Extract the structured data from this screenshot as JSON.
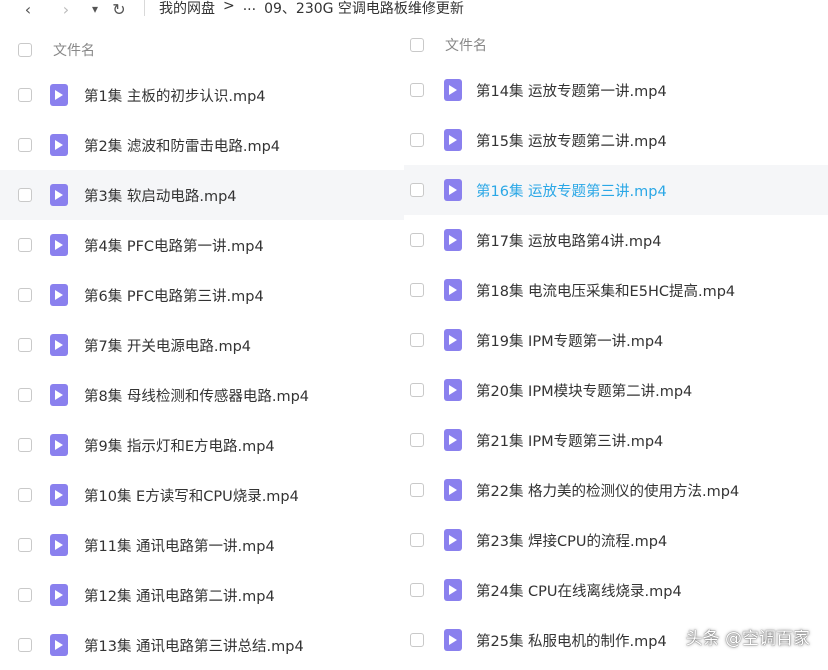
{
  "nav": {
    "back_icon": "‹",
    "forward_icon": "›",
    "dropdown_icon": "▾",
    "refresh_icon": "↻"
  },
  "breadcrumb": {
    "root": "我的网盘",
    "sep": ">",
    "ellipsis": "...",
    "current": "09、230G 空调电路板维修更新"
  },
  "left": {
    "header": "文件名",
    "files": [
      "第1集  主板的初步认识.mp4",
      "第2集 滤波和防雷击电路.mp4",
      "第3集  软启动电路.mp4",
      "第4集  PFC电路第一讲.mp4",
      "第6集 PFC电路第三讲.mp4",
      "第7集  开关电源电路.mp4",
      "第8集 母线检测和传感器电路.mp4",
      "第9集 指示灯和E方电路.mp4",
      "第10集 E方读写和CPU烧录.mp4",
      "第11集  通讯电路第一讲.mp4",
      "第12集 通讯电路第二讲.mp4",
      "第13集 通讯电路第三讲总结.mp4"
    ]
  },
  "right": {
    "header": "文件名",
    "files": [
      "第14集 运放专题第一讲.mp4",
      "第15集 运放专题第二讲.mp4",
      "第16集  运放专题第三讲.mp4",
      "第17集 运放电路第4讲.mp4",
      "第18集 电流电压采集和E5HC提高.mp4",
      "第19集 IPM专题第一讲.mp4",
      "第20集 IPM模块专题第二讲.mp4",
      "第21集 IPM专题第三讲.mp4",
      "第22集 格力美的检测仪的使用方法.mp4",
      "第23集 焊接CPU的流程.mp4",
      "第24集 CPU在线离线烧录.mp4",
      "第25集 私服电机的制作.mp4"
    ]
  },
  "watermark": "头条 @空调百家",
  "colors": {
    "icon": "#8a80ee",
    "active_text": "#2aa7e6",
    "hover_bg": "#f5f6f8"
  }
}
